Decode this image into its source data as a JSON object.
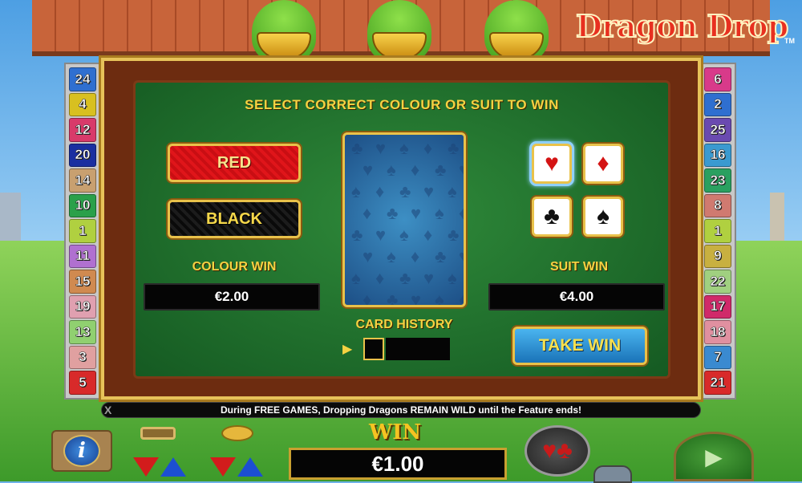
{
  "game": {
    "logo_text": "Dragon Drop",
    "logo_tm": "TM"
  },
  "left_numbers": [
    {
      "n": "24",
      "color": "#2f6fd0"
    },
    {
      "n": "4",
      "color": "#d8c020"
    },
    {
      "n": "12",
      "color": "#d83a6a"
    },
    {
      "n": "20",
      "color": "#1a2fa0"
    },
    {
      "n": "14",
      "color": "#c8a070"
    },
    {
      "n": "10",
      "color": "#2aa04a"
    },
    {
      "n": "1",
      "color": "#b0d040"
    },
    {
      "n": "11",
      "color": "#b070d0"
    },
    {
      "n": "15",
      "color": "#d08a50"
    },
    {
      "n": "19",
      "color": "#e0a0b0"
    },
    {
      "n": "13",
      "color": "#90d070"
    },
    {
      "n": "3",
      "color": "#e0a0a0"
    },
    {
      "n": "5",
      "color": "#d82a2a"
    }
  ],
  "right_numbers": [
    {
      "n": "6",
      "color": "#d83a8a"
    },
    {
      "n": "2",
      "color": "#2f6fd0"
    },
    {
      "n": "25",
      "color": "#6a4ab0"
    },
    {
      "n": "16",
      "color": "#3a9ad0"
    },
    {
      "n": "23",
      "color": "#2aa060"
    },
    {
      "n": "8",
      "color": "#d07a70"
    },
    {
      "n": "1",
      "color": "#b0d040"
    },
    {
      "n": "9",
      "color": "#c8b040"
    },
    {
      "n": "22",
      "color": "#a0d080"
    },
    {
      "n": "17",
      "color": "#d02a6a"
    },
    {
      "n": "18",
      "color": "#e090a0"
    },
    {
      "n": "7",
      "color": "#3a8ad0"
    },
    {
      "n": "21",
      "color": "#d82a2a"
    }
  ],
  "gamble": {
    "title": "SELECT CORRECT COLOUR OR SUIT TO WIN",
    "red_label": "RED",
    "black_label": "BLACK",
    "colour_win_label": "COLOUR WIN",
    "colour_win_value": "€2.00",
    "suit_win_label": "SUIT WIN",
    "suit_win_value": "€4.00",
    "card_history_label": "CARD HISTORY",
    "take_win_label": "TAKE WIN",
    "suits": [
      {
        "glyph": "♥",
        "name": "heart",
        "color": "#d41414",
        "selected": true
      },
      {
        "glyph": "♦",
        "name": "diamond",
        "color": "#d41414",
        "selected": false
      },
      {
        "glyph": "♣",
        "name": "club",
        "color": "#111111",
        "selected": false
      },
      {
        "glyph": "♠",
        "name": "spade",
        "color": "#111111",
        "selected": false
      }
    ]
  },
  "ticker": {
    "close": "X",
    "message": "During FREE GAMES, Dropping Dragons REMAIN WILD until the Feature ends!"
  },
  "bottom": {
    "info_glyph": "i",
    "win_label": "WIN",
    "win_value": "€1.00",
    "gamble_glyph": "♥♣",
    "spin_glyph": "▶"
  }
}
